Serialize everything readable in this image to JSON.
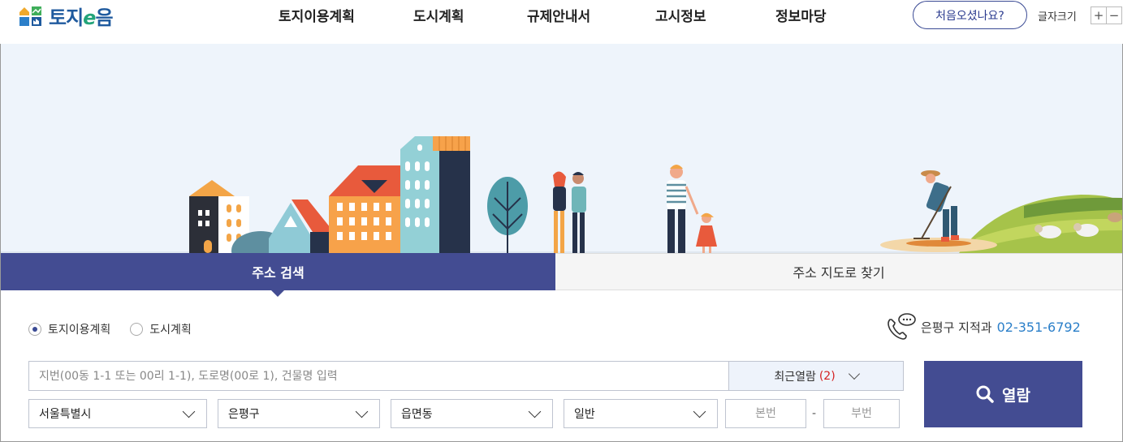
{
  "header": {
    "logo_text_a": "토지",
    "logo_text_e": "e",
    "logo_text_b": "음",
    "nav": [
      "토지이용계획",
      "도시계획",
      "규제안내서",
      "고시정보",
      "정보마당"
    ],
    "first_visit_label": "처음오셨나요?",
    "font_size_label": "글자크기",
    "font_plus": "+",
    "font_minus": "−"
  },
  "tabs": {
    "address_search": "주소 검색",
    "map_search": "주소 지도로 찾기"
  },
  "search": {
    "radio_land": "토지이용계획",
    "radio_city": "도시계획",
    "phone_label": "은평구 지적과",
    "phone_number": "02-351-6792",
    "input_placeholder": "지번(00동 1-1 또는 00리 1-1), 도로명(00로 1), 건물명 입력",
    "recent_label": "최근열람",
    "recent_count": "(2)",
    "select_sido": "서울특별시",
    "select_sigungu": "은평구",
    "select_dong": "읍면동",
    "select_type": "일반",
    "main_no_placeholder": "본번",
    "sub_no_placeholder": "부번",
    "dash": "-",
    "view_label": "열람"
  },
  "colors": {
    "primary": "#434c92",
    "phone": "#2b7fc9",
    "recent_count": "#d42020"
  }
}
